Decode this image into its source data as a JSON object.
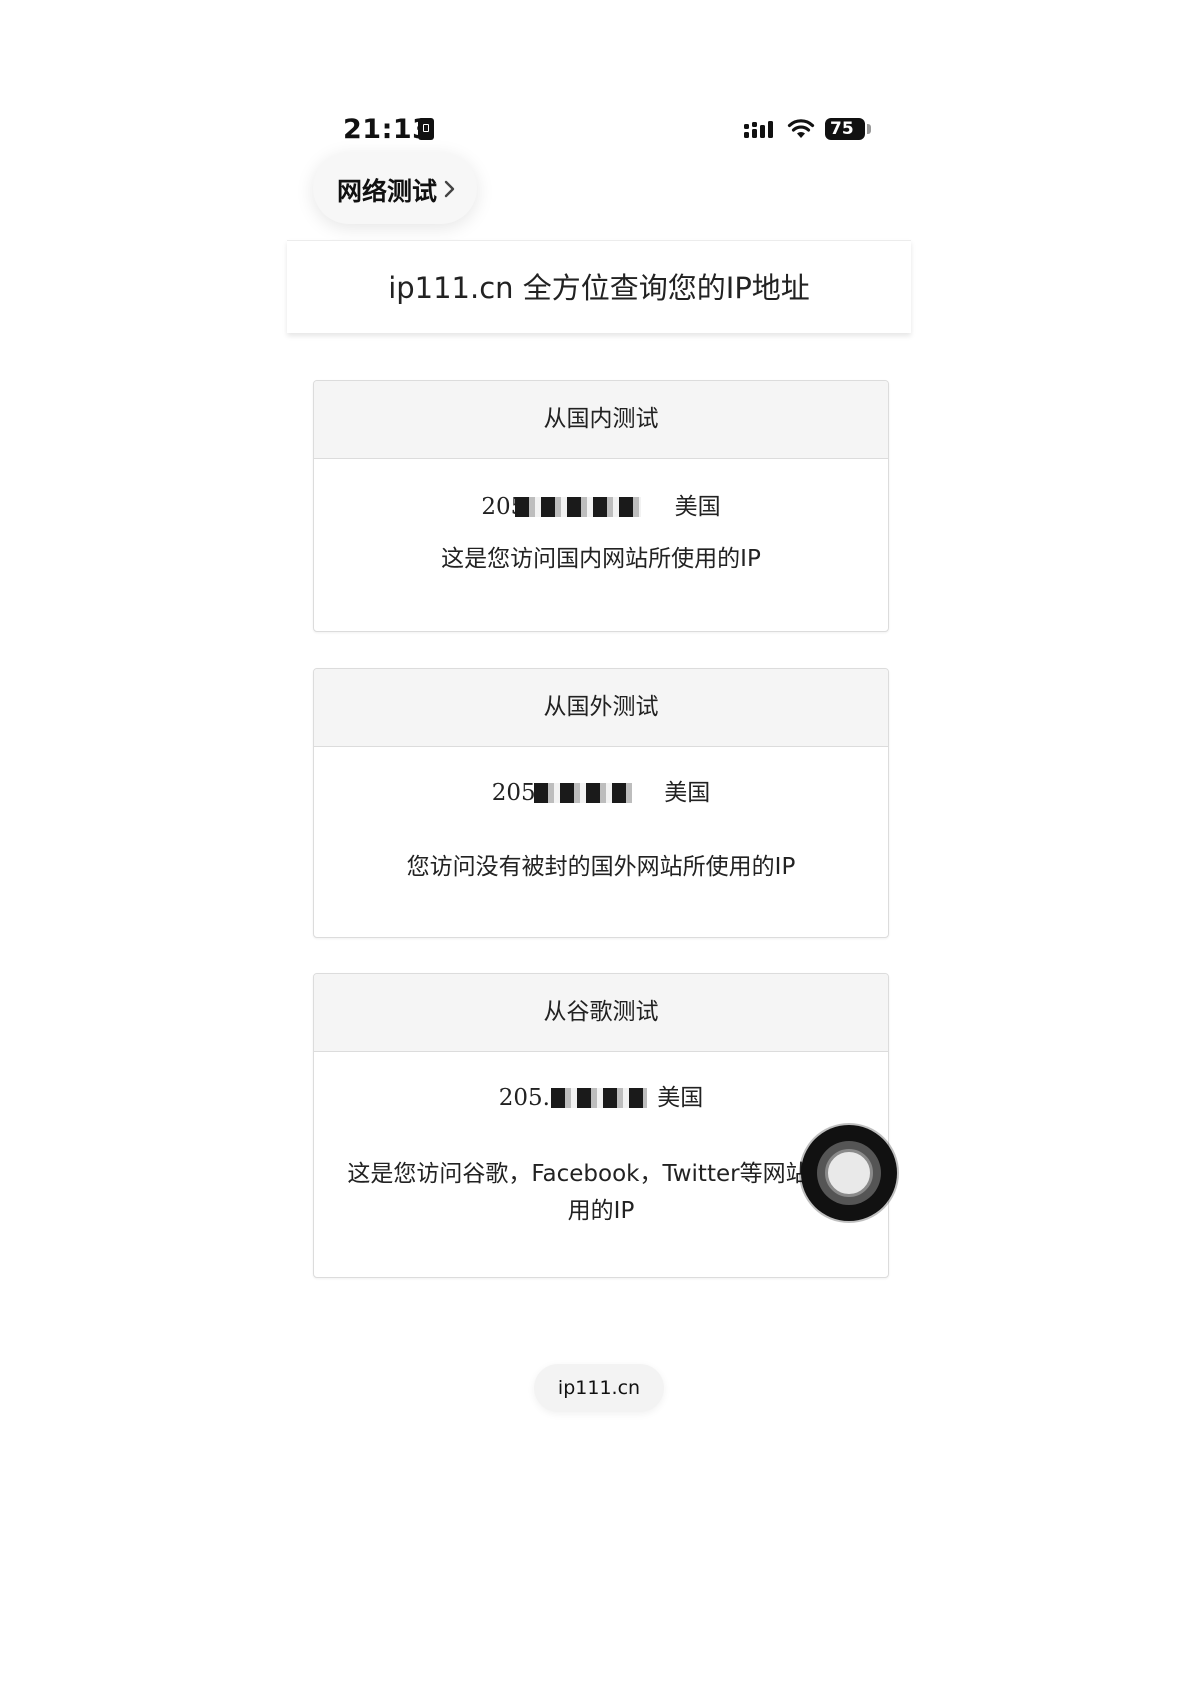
{
  "status_bar": {
    "time": "21:13",
    "battery": "75"
  },
  "nav": {
    "back_label": "网络测试"
  },
  "page": {
    "title": "ip111.cn 全方位查询您的IP地址"
  },
  "cards": [
    {
      "heading": "从国内测试",
      "ip": "205",
      "location": "美国",
      "description": "这是您访问国内网站所使用的IP"
    },
    {
      "heading": "从国外测试",
      "ip": "205.",
      "location": "美国",
      "description": "您访问没有被封的国外网站所使用的IP"
    },
    {
      "heading": "从谷歌测试",
      "ip": "205.",
      "location": "美国",
      "description": "这是您访问谷歌，Facebook，Twitter等网站所使用的IP"
    }
  ],
  "browser": {
    "url": "ip111.cn"
  },
  "icons": [
    "signal-icon",
    "wifi-icon",
    "battery-icon",
    "chevron-right-icon",
    "assistive-touch-icon",
    "id-card-icon"
  ]
}
